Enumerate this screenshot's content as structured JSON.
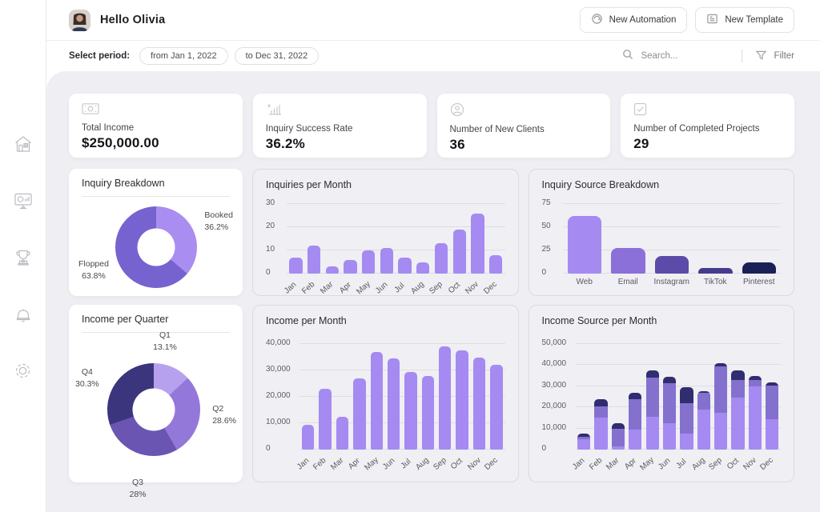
{
  "header": {
    "greeting": "Hello Olivia",
    "new_automation_label": "New Automation",
    "new_template_label": "New Template"
  },
  "filterbar": {
    "select_period_label": "Select period:",
    "from_value": "from Jan 1, 2022",
    "to_value": "to Dec 31, 2022",
    "search_placeholder": "Search...",
    "filter_label": "Filter"
  },
  "sidebar": {
    "items": [
      {
        "icon": "home-icon"
      },
      {
        "icon": "dashboard-icon"
      },
      {
        "icon": "trophy-icon"
      },
      {
        "icon": "bell-icon"
      },
      {
        "icon": "settings-icon"
      }
    ]
  },
  "stats": [
    {
      "icon": "money-icon",
      "label": "Total Income",
      "value": "$250,000.00"
    },
    {
      "icon": "success-rate-icon",
      "label": "Inquiry Success Rate",
      "value": "36.2%"
    },
    {
      "icon": "new-clients-icon",
      "label": "Number of New Clients",
      "value": "36"
    },
    {
      "icon": "completed-projects-icon",
      "label": "Number of Completed Projects",
      "value": "29"
    }
  ],
  "colors": {
    "accent_light_purple": "#a58af2",
    "accent_mid_purple": "#7763cf",
    "accent_dark_indigo": "#3b357d",
    "accent_navy": "#1b2157",
    "dashboard_bg": "#efeef2",
    "card_bg": "#ffffff"
  },
  "chart_data": [
    {
      "id": "inquiry_breakdown",
      "type": "pie",
      "title": "Inquiry Breakdown",
      "slices": [
        {
          "label": "Booked",
          "pct": "36.2%",
          "value": 36.2,
          "color": "#a98df0"
        },
        {
          "label": "Flopped",
          "pct": "63.8%",
          "value": 63.8,
          "color": "#7763cf"
        }
      ]
    },
    {
      "id": "inquiries_per_month",
      "type": "bar",
      "title": "Inquiries per Month",
      "categories": [
        "Jan",
        "Feb",
        "Mar",
        "Apr",
        "May",
        "Jun",
        "Jul",
        "Aug",
        "Sep",
        "Oct",
        "Nov",
        "Dec"
      ],
      "values": [
        7,
        12,
        3,
        6,
        10,
        11,
        7,
        5,
        13,
        19,
        26,
        8
      ],
      "color": "#a58af2",
      "ymax": 30,
      "yticks": [
        0,
        10,
        20,
        30
      ],
      "ytick_labels": [
        "0",
        "10",
        "20",
        "30"
      ],
      "ylabel_width": 26,
      "rotate_x": true,
      "grid": true,
      "legend": "none"
    },
    {
      "id": "inquiry_source_breakdown",
      "type": "bar",
      "title": "Inquiry Source Breakdown",
      "categories": [
        "Web",
        "Email",
        "Instagram",
        "TikTok",
        "Pinterest"
      ],
      "values": [
        62,
        28,
        19,
        6,
        12
      ],
      "colors": [
        "#a58af2",
        "#8a70d8",
        "#5c4ba8",
        "#453c8c",
        "#1b2157"
      ],
      "ymax": 75,
      "yticks": [
        0,
        25,
        50,
        75
      ],
      "ytick_labels": [
        "0",
        "25",
        "50",
        "75"
      ],
      "ylabel_width": 26,
      "rotate_x": false,
      "grid": true,
      "legend": "none"
    },
    {
      "id": "income_per_quarter",
      "type": "pie",
      "title": "Income per Quarter",
      "slices": [
        {
          "label": "Q1",
          "pct": "13.1%",
          "value": 13.1,
          "color": "#b6a1ee"
        },
        {
          "label": "Q2",
          "pct": "28.6%",
          "value": 28.6,
          "color": "#9378da"
        },
        {
          "label": "Q3",
          "pct": "28%",
          "value": 28.0,
          "color": "#6a56b2"
        },
        {
          "label": "Q4",
          "pct": "30.3%",
          "value": 30.3,
          "color": "#3b357d"
        }
      ]
    },
    {
      "id": "income_per_month",
      "type": "bar",
      "title": "Income per Month",
      "categories": [
        "Jan",
        "Feb",
        "Mar",
        "Apr",
        "May",
        "Jun",
        "Jul",
        "Aug",
        "Sep",
        "Oct",
        "Nov",
        "Dec"
      ],
      "values": [
        9500,
        23000,
        12500,
        27000,
        37000,
        34500,
        29500,
        28000,
        39000,
        37500,
        35000,
        32000
      ],
      "color": "#a58af2",
      "ymax": 40000,
      "yticks": [
        0,
        10000,
        20000,
        30000,
        40000
      ],
      "ytick_labels": [
        "0",
        "10,000",
        "20,000",
        "30,000",
        "40,000"
      ],
      "ylabel_width": 42,
      "rotate_x": true,
      "grid": true,
      "legend": "none"
    },
    {
      "id": "income_source_per_month",
      "type": "stacked-bar",
      "title": "Income Source per Month",
      "categories": [
        "Jan",
        "Feb",
        "Mar",
        "Apr",
        "May",
        "Jun",
        "Jul",
        "Aug",
        "Sep",
        "Oct",
        "Nov",
        "Dec"
      ],
      "series": [
        {
          "name": "bottom-segment",
          "color": "#a58af2",
          "values": [
            5000,
            15000,
            1500,
            9500,
            15500,
            12500,
            7500,
            19000,
            17500,
            24500,
            30000,
            14500
          ]
        },
        {
          "name": "middle-segment",
          "color": "#8471ce",
          "values": [
            1000,
            5500,
            8500,
            14500,
            18500,
            19000,
            14500,
            8000,
            22000,
            8500,
            3000,
            16000
          ]
        },
        {
          "name": "top-segment",
          "color": "#302d70",
          "values": [
            1500,
            3500,
            2500,
            3000,
            3500,
            3000,
            7500,
            500,
            1500,
            4500,
            2000,
            1500
          ]
        }
      ],
      "ymax": 50000,
      "yticks": [
        0,
        10000,
        20000,
        30000,
        40000,
        50000
      ],
      "ytick_labels": [
        "0",
        "10,000",
        "20,000",
        "30,000",
        "40,000",
        "50,000"
      ],
      "ylabel_width": 42,
      "rotate_x": true,
      "grid": true,
      "legend": "none"
    }
  ]
}
